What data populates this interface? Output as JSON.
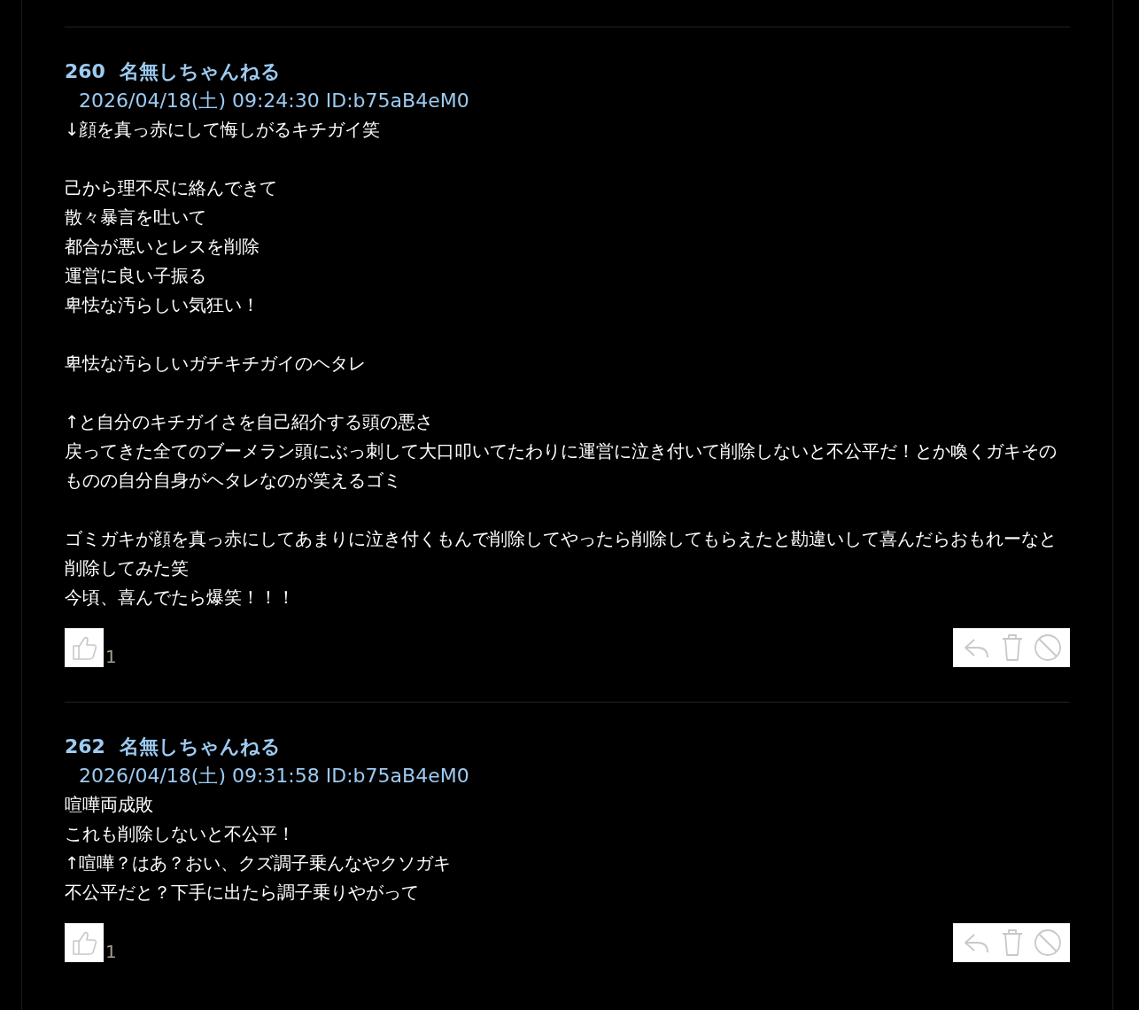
{
  "posts": [
    {
      "number": "260",
      "name": "名無しちゃんねる",
      "meta": "2026/04/18(土) 09:24:30 ID:b75aB4eM0",
      "paragraphs": [
        [
          "↓顔を真っ赤にして悔しがるキチガイ笑"
        ],
        [
          "己から理不尽に絡んできて",
          "散々暴言を吐いて",
          "都合が悪いとレスを削除",
          "運営に良い子振る",
          "卑怯な汚らしい気狂い！"
        ],
        [
          "卑怯な汚らしいガチキチガイのヘタレ"
        ],
        [
          "↑と自分のキチガイさを自己紹介する頭の悪さ",
          "戻ってきた全てのブーメラン頭にぶっ刺して大口叩いてたわりに運営に泣き付いて削除しないと不公平だ！とか喚くガキそのものの自分自身がヘタレなのが笑えるゴミ"
        ],
        [
          "ゴミガキが顔を真っ赤にしてあまりに泣き付くもんで削除してやったら削除してもらえたと勘違いして喜んだらおもれーなと削除してみた笑",
          "今頃、喜んでたら爆笑！！！"
        ]
      ],
      "likes": "1"
    },
    {
      "number": "262",
      "name": "名無しちゃんねる",
      "meta": "2026/04/18(土) 09:31:58 ID:b75aB4eM0",
      "paragraphs": [
        [
          "喧嘩両成敗",
          "これも削除しないと不公平！",
          "↑喧嘩？はあ？おい、クズ調子乗んなやクソガキ",
          "不公平だと？下手に出たら調子乗りやがって"
        ]
      ],
      "likes": "1"
    }
  ]
}
